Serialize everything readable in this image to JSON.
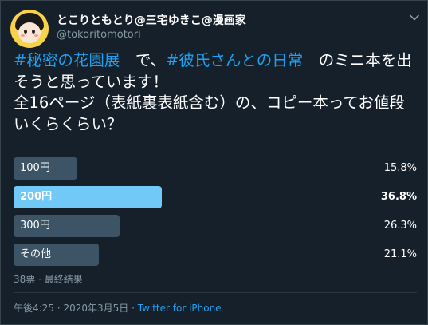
{
  "author": {
    "display_name": "とこりともとり@三宅ゆきこ@漫画家",
    "handle": "@tokoritomotori"
  },
  "icons": {
    "avatar": "avatar-illustration",
    "menu": "chevron-down-icon"
  },
  "tweet": {
    "hashtag1": "#秘密の花園展",
    "text1": "　で、",
    "hashtag2": "#彼氏さんとの日常",
    "text2": "　のミニ本を出そうと思っています！",
    "text3": "全16ページ（表紙裏表紙含む）の、コピー本ってお値段いくらくらい？"
  },
  "poll": {
    "options": [
      {
        "label": "100円",
        "percent": "15.8%",
        "share": 0.158,
        "winner": false
      },
      {
        "label": "200円",
        "percent": "36.8%",
        "share": 0.368,
        "winner": true
      },
      {
        "label": "300円",
        "percent": "26.3%",
        "share": 0.263,
        "winner": false
      },
      {
        "label": "その他",
        "percent": "21.1%",
        "share": 0.211,
        "winner": false
      }
    ],
    "votes": "38票",
    "separator": "·",
    "status": "最終結果"
  },
  "meta": {
    "time": "午後4:25",
    "separator": "·",
    "date": "2020年3月5日",
    "source": "Twitter for iPhone"
  },
  "colors": {
    "background": "#15202b",
    "accent": "#1da1f2",
    "winner_bar": "#71c9f8",
    "bar": "#3d5466",
    "muted_text": "#8899a6"
  }
}
